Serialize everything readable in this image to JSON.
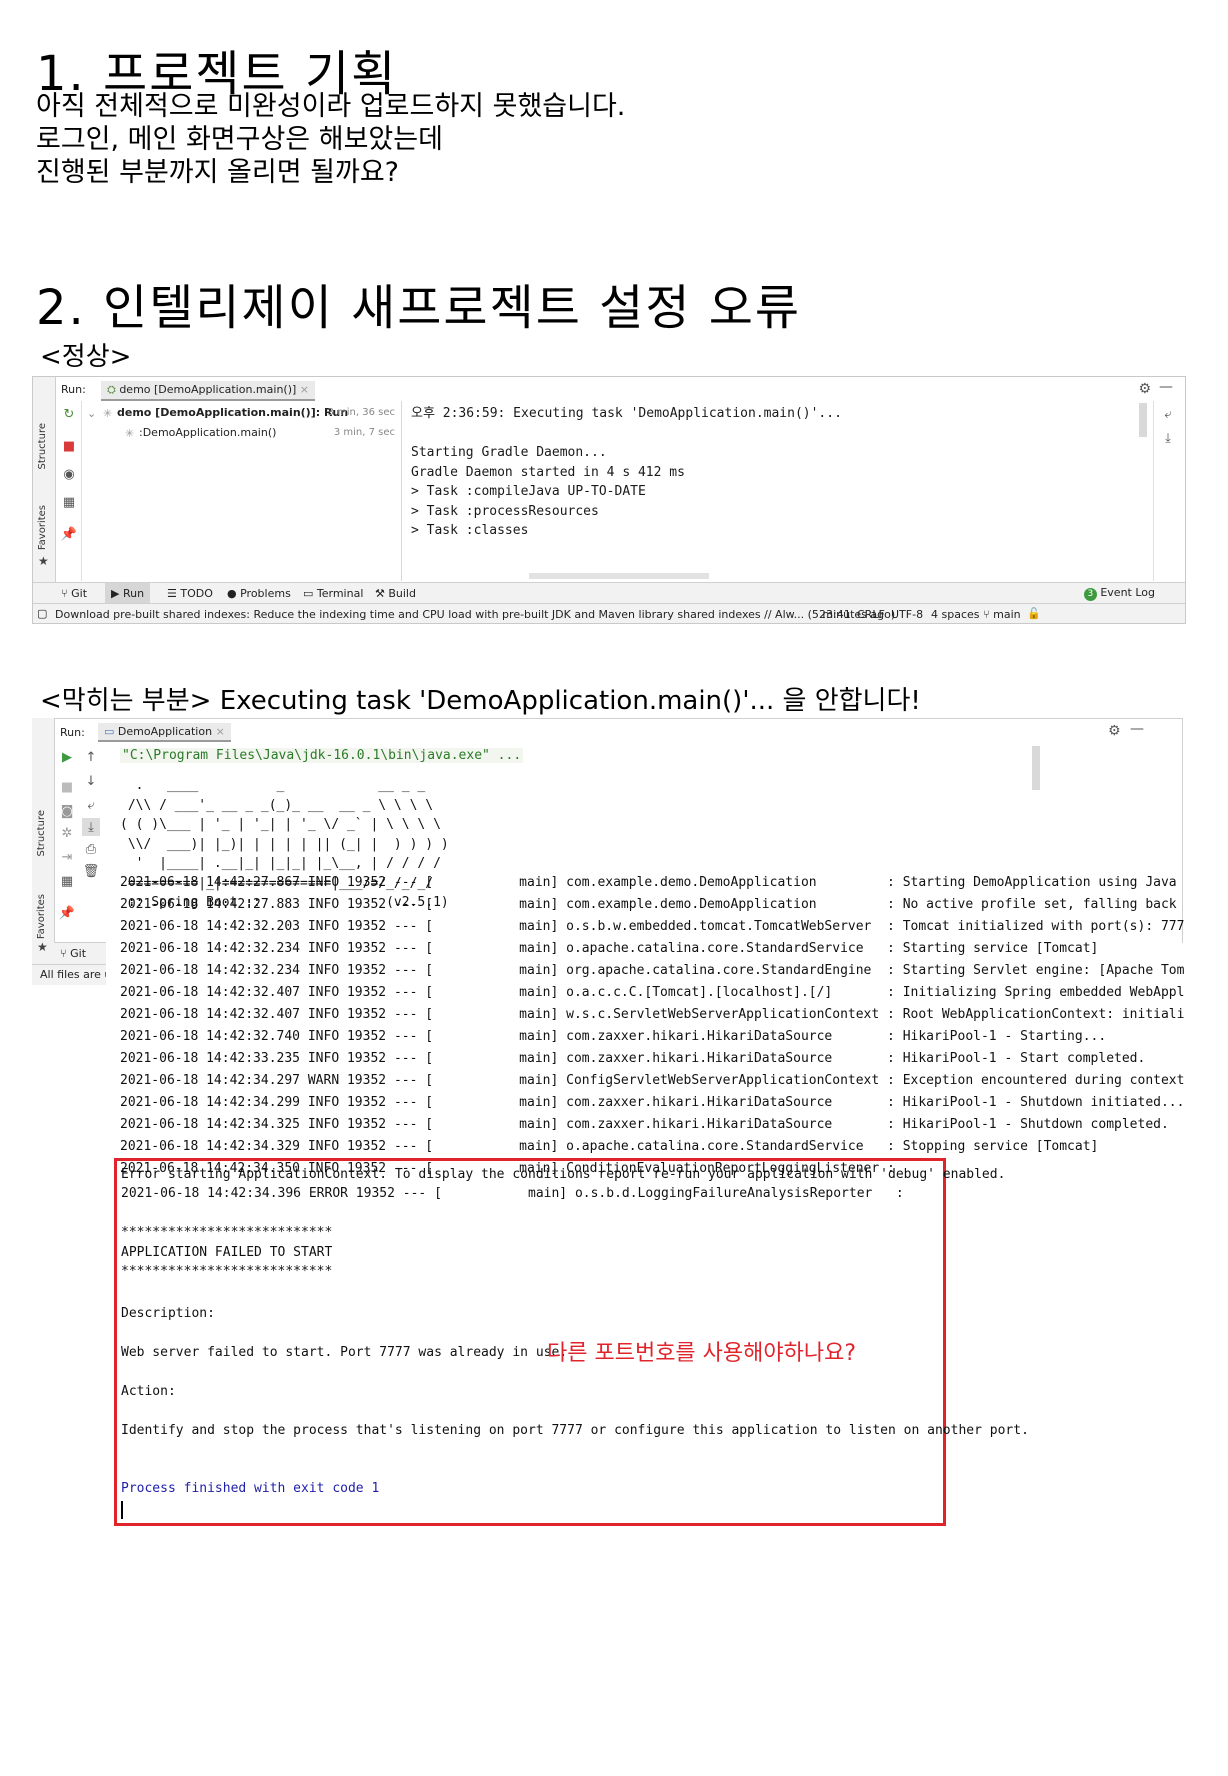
{
  "section1": {
    "title": "1. 프로젝트 기획",
    "lines": [
      "아직 전체적으로 미완성이라 업로드하지 못했습니다.",
      "로그인, 메인 화면구상은 해보았는데",
      "진행된 부분까지 올리면 될까요?"
    ]
  },
  "section2": {
    "title": "2. 인텔리제이 새프로젝트 설정 오류",
    "normal_label": "<정상>",
    "blocked_label": "<막히는 부분> Executing task 'DemoApplication.main()'... 을 안합니다!"
  },
  "ide1": {
    "run_label": "Run:",
    "tab_label": "demo [DemoApplication.main()]",
    "tree": [
      {
        "label": "demo [DemoApplication.main()]: Run",
        "time": "3 min, 36 sec"
      },
      {
        "label": ":DemoApplication.main()",
        "time": "3 min, 7 sec"
      }
    ],
    "console": [
      "오후 2:36:59: Executing task 'DemoApplication.main()'...",
      "",
      "Starting Gradle Daemon...",
      "Gradle Daemon started in 4 s 412 ms",
      "> Task :compileJava UP-TO-DATE",
      "> Task :processResources",
      "> Task :classes"
    ],
    "side_labels": [
      "Structure",
      "Favorites"
    ],
    "bottom_tabs": [
      "Git",
      "Run",
      "TODO",
      "Problems",
      "Terminal",
      "Build"
    ],
    "event_log": "Event Log",
    "event_count": "3",
    "status_msg": "Download pre-built shared indexes: Reduce the indexing time and CPU load with pre-built JDK and Maven library shared indexes // Alw... (5 minutes ago)",
    "status_right": [
      "23:41",
      "CRLF",
      "UTF-8",
      "4 spaces",
      "main"
    ]
  },
  "ide2": {
    "run_label": "Run:",
    "tab_label": "DemoApplication",
    "cmd": "\"C:\\Program Files\\Java\\jdk-16.0.1\\bin\\java.exe\" ...",
    "banner": [
      "  .   ____          _            __ _ _",
      " /\\\\ / ___'_ __ _ _(_)_ __  __ _ \\ \\ \\ \\",
      "( ( )\\___ | '_ | '_| | '_ \\/ _` | \\ \\ \\ \\",
      " \\\\/  ___)| |_)| | | | | || (_| |  ) ) ) )",
      "  '  |____| .__|_| |_|_| |_\\__, | / / / /",
      " =========|_|==============|___/=/_/_/_/",
      " :: Spring Boot ::                (v2.5.1)"
    ],
    "side_labels": [
      "Structure",
      "Favorites"
    ],
    "git_tab": "Git",
    "all_files": "All files are u",
    "log": [
      {
        "ts": "2021-06-18 14:42:27.867",
        "lvl": "INFO",
        "pid": "19352",
        "logger": "com.example.demo.DemoApplication",
        "msg": ": Starting DemoApplication using Java"
      },
      {
        "ts": "2021-06-18 14:42:27.883",
        "lvl": "INFO",
        "pid": "19352",
        "logger": "com.example.demo.DemoApplication",
        "msg": ": No active profile set, falling back"
      },
      {
        "ts": "2021-06-18 14:42:32.203",
        "lvl": "INFO",
        "pid": "19352",
        "logger": "o.s.b.w.embedded.tomcat.TomcatWebServer",
        "msg": ": Tomcat initialized with port(s): 777"
      },
      {
        "ts": "2021-06-18 14:42:32.234",
        "lvl": "INFO",
        "pid": "19352",
        "logger": "o.apache.catalina.core.StandardService",
        "msg": ": Starting service [Tomcat]"
      },
      {
        "ts": "2021-06-18 14:42:32.234",
        "lvl": "INFO",
        "pid": "19352",
        "logger": "org.apache.catalina.core.StandardEngine",
        "msg": ": Starting Servlet engine: [Apache Tom"
      },
      {
        "ts": "2021-06-18 14:42:32.407",
        "lvl": "INFO",
        "pid": "19352",
        "logger": "o.a.c.c.C.[Tomcat].[localhost].[/]",
        "msg": ": Initializing Spring embedded WebAppl"
      },
      {
        "ts": "2021-06-18 14:42:32.407",
        "lvl": "INFO",
        "pid": "19352",
        "logger": "w.s.c.ServletWebServerApplicationContext",
        "msg": ": Root WebApplicationContext: initiali"
      },
      {
        "ts": "2021-06-18 14:42:32.740",
        "lvl": "INFO",
        "pid": "19352",
        "logger": "com.zaxxer.hikari.HikariDataSource",
        "msg": ": HikariPool-1 - Starting..."
      },
      {
        "ts": "2021-06-18 14:42:33.235",
        "lvl": "INFO",
        "pid": "19352",
        "logger": "com.zaxxer.hikari.HikariDataSource",
        "msg": ": HikariPool-1 - Start completed."
      },
      {
        "ts": "2021-06-18 14:42:34.297",
        "lvl": "WARN",
        "pid": "19352",
        "logger": "ConfigServletWebServerApplicationContext",
        "msg": ": Exception encountered during context"
      },
      {
        "ts": "2021-06-18 14:42:34.299",
        "lvl": "INFO",
        "pid": "19352",
        "logger": "com.zaxxer.hikari.HikariDataSource",
        "msg": ": HikariPool-1 - Shutdown initiated..."
      },
      {
        "ts": "2021-06-18 14:42:34.325",
        "lvl": "INFO",
        "pid": "19352",
        "logger": "com.zaxxer.hikari.HikariDataSource",
        "msg": ": HikariPool-1 - Shutdown completed."
      },
      {
        "ts": "2021-06-18 14:42:34.329",
        "lvl": "INFO",
        "pid": "19352",
        "logger": "o.apache.catalina.core.StandardService",
        "msg": ": Stopping service [Tomcat]"
      },
      {
        "ts": "2021-06-18 14:42:34.350",
        "lvl": "INFO",
        "pid": "19352",
        "logger": "ConditionEvaluationReportLoggingListener",
        "msg": ":"
      }
    ],
    "error": {
      "line1": "Error starting ApplicationContext. To display the conditions report re-run your application with 'debug' enabled.",
      "line2": "2021-06-18 14:42:34.396 ERROR 19352 --- [           main] o.s.b.d.LoggingFailureAnalysisReporter   :",
      "stars": "***************************",
      "failed": "APPLICATION FAILED TO START",
      "desc_label": "Description:",
      "desc": "Web server failed to start. Port 7777 was already in use.",
      "question": "다른 포트번호를 사용해야하나요?",
      "action_label": "Action:",
      "action": "Identify and stop the process that's listening on port 7777 or configure this application to listen on another port.",
      "exit": "Process finished with exit code 1"
    }
  },
  "colors": {
    "accent_red": "#e0242c",
    "console_blue": "#1f1fa8",
    "sidebar": "#f2f2f2"
  }
}
